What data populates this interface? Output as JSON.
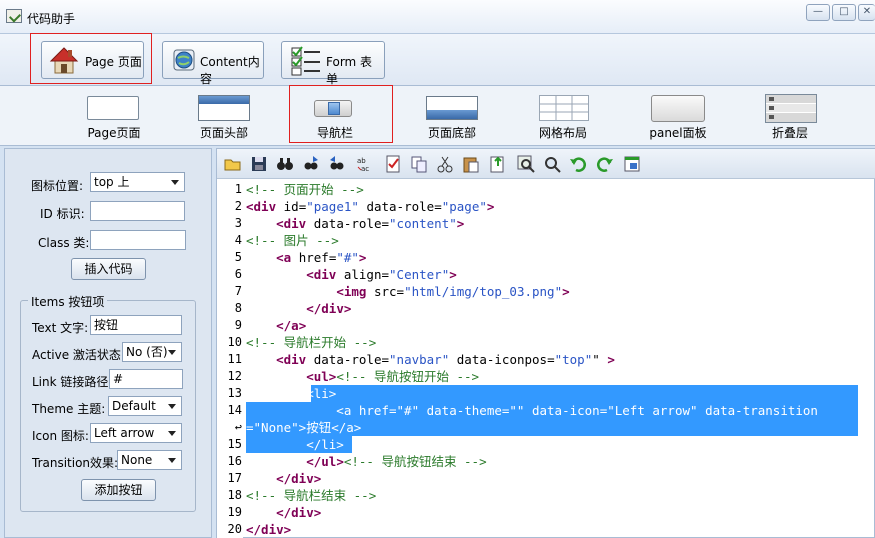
{
  "window": {
    "title": "代码助手",
    "minimize": "—",
    "maximize": "□",
    "close": "✕"
  },
  "top_toolbar": [
    {
      "label": "Page 页面",
      "icon": "house-icon"
    },
    {
      "label": "Content内容",
      "icon": "globe-icon"
    },
    {
      "label": "Form 表单",
      "icon": "checklist-icon"
    }
  ],
  "components": [
    {
      "label": "Page页面"
    },
    {
      "label": "页面头部"
    },
    {
      "label": "导航栏"
    },
    {
      "label": "页面底部"
    },
    {
      "label": "网格布局"
    },
    {
      "label": "panel面板"
    },
    {
      "label": "折叠层"
    }
  ],
  "form": {
    "icon_position_label": "图标位置:",
    "icon_position_value": "top 上",
    "id_label": "ID 标识:",
    "id_value": "",
    "class_label": "Class 类:",
    "class_value": "",
    "insert_button": "插入代码",
    "items_group": "Items 按钮项",
    "text_label": "Text 文字:",
    "text_value": "按钮",
    "active_label": "Active 激活状态:",
    "active_value": "No (否)",
    "link_label": "Link 链接路径:",
    "link_value": "#",
    "theme_label": "Theme 主题:",
    "theme_value": "Default",
    "icon_label": "Icon 图标:",
    "icon_value": "Left arrow",
    "transition_label": "Transition效果:",
    "transition_value": "None",
    "add_button": "添加按钮"
  },
  "editor_toolbar": [
    "open-folder-icon",
    "save-icon",
    "binoculars-icon",
    "find-next-icon",
    "find-prev-icon",
    "spellcheck-icon",
    "document-icon",
    "copy-icon",
    "cut-icon",
    "paste-icon",
    "export-icon",
    "zoom-in-icon",
    "zoom-out-icon",
    "undo-icon",
    "redo-icon",
    "window-icon"
  ],
  "code": {
    "line_numbers": [
      "1",
      "2",
      "3",
      "4",
      "5",
      "6",
      "7",
      "8",
      "9",
      "10",
      "11",
      "12",
      "13",
      "14",
      "↩",
      "15",
      "16",
      "17",
      "18",
      "19",
      "20"
    ],
    "lines": [
      "<!-- 页面开始 -->",
      "<div id=\"page1\" data-role=\"page\">",
      "    <div data-role=\"content\">",
      "<!-- 图片 -->",
      "    <a href=\"#\">",
      "        <div align=\"Center\">",
      "            <img src=\"html/img/top_03.png\">",
      "        </div>",
      "    </a>",
      "<!-- 导航栏开始 -->",
      "    <div data-role=\"navbar\" data-iconpos=\"top\"\" >",
      "        <ul><!-- 导航按钮开始 -->",
      "        <li>",
      "            <a href=\"#\" data-theme=\"\" data-icon=\"Left arrow\" data-transition",
      "=\"None\">按钮</a>",
      "        </li>",
      "        </ul><!-- 导航按钮结束 -->",
      "    </div>",
      "<!-- 导航栏结束 -->",
      "    </div>",
      "</div>"
    ]
  }
}
